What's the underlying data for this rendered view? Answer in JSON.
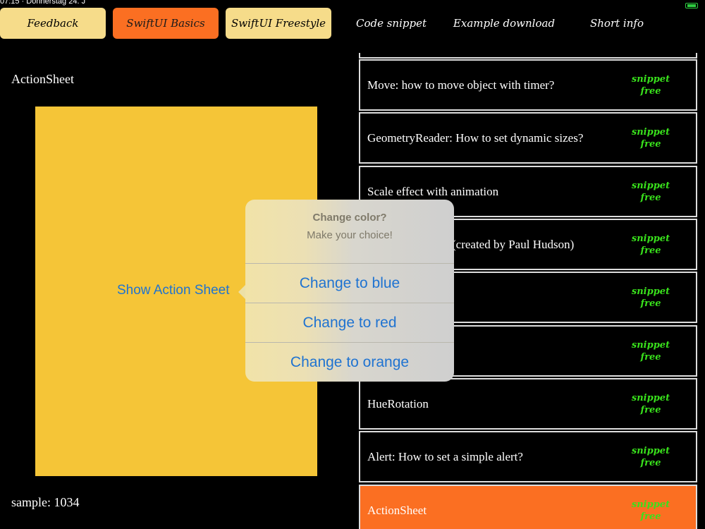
{
  "status": {
    "text": "07:15 · Donnerstag 24. J"
  },
  "nav": {
    "feedback": "Feedback",
    "basics": "SwiftUI Basics",
    "freestyle": "SwiftUI Freestyle",
    "code_snippet": "Code snippet",
    "example_download": "Example download",
    "short_info": "Short info"
  },
  "left": {
    "title": "ActionSheet",
    "show_button": "Show Action Sheet",
    "sample": "sample: 1034"
  },
  "popover": {
    "title": "Change color?",
    "message": "Make your choice!",
    "actions": [
      "Change to blue",
      "Change to red",
      "Change to orange"
    ]
  },
  "list": {
    "tag_line1": "snippet",
    "tag_line2": "free",
    "items": [
      "Move: how to move object with timer?",
      "GeometryReader: How to set dynamic sizes?",
      "Scale effect with animation",
      "(created by Paul Hudson)",
      "",
      "",
      "HueRotation",
      "Alert: How to set a simple alert?",
      "ActionSheet"
    ],
    "selected_index": 8
  },
  "colors": {
    "accent_orange": "#fb6f22",
    "nav_light": "#f6dc8a",
    "panel_yellow": "#f5c537",
    "tag_green": "#39e11c",
    "ios_blue": "#1f73d1"
  }
}
